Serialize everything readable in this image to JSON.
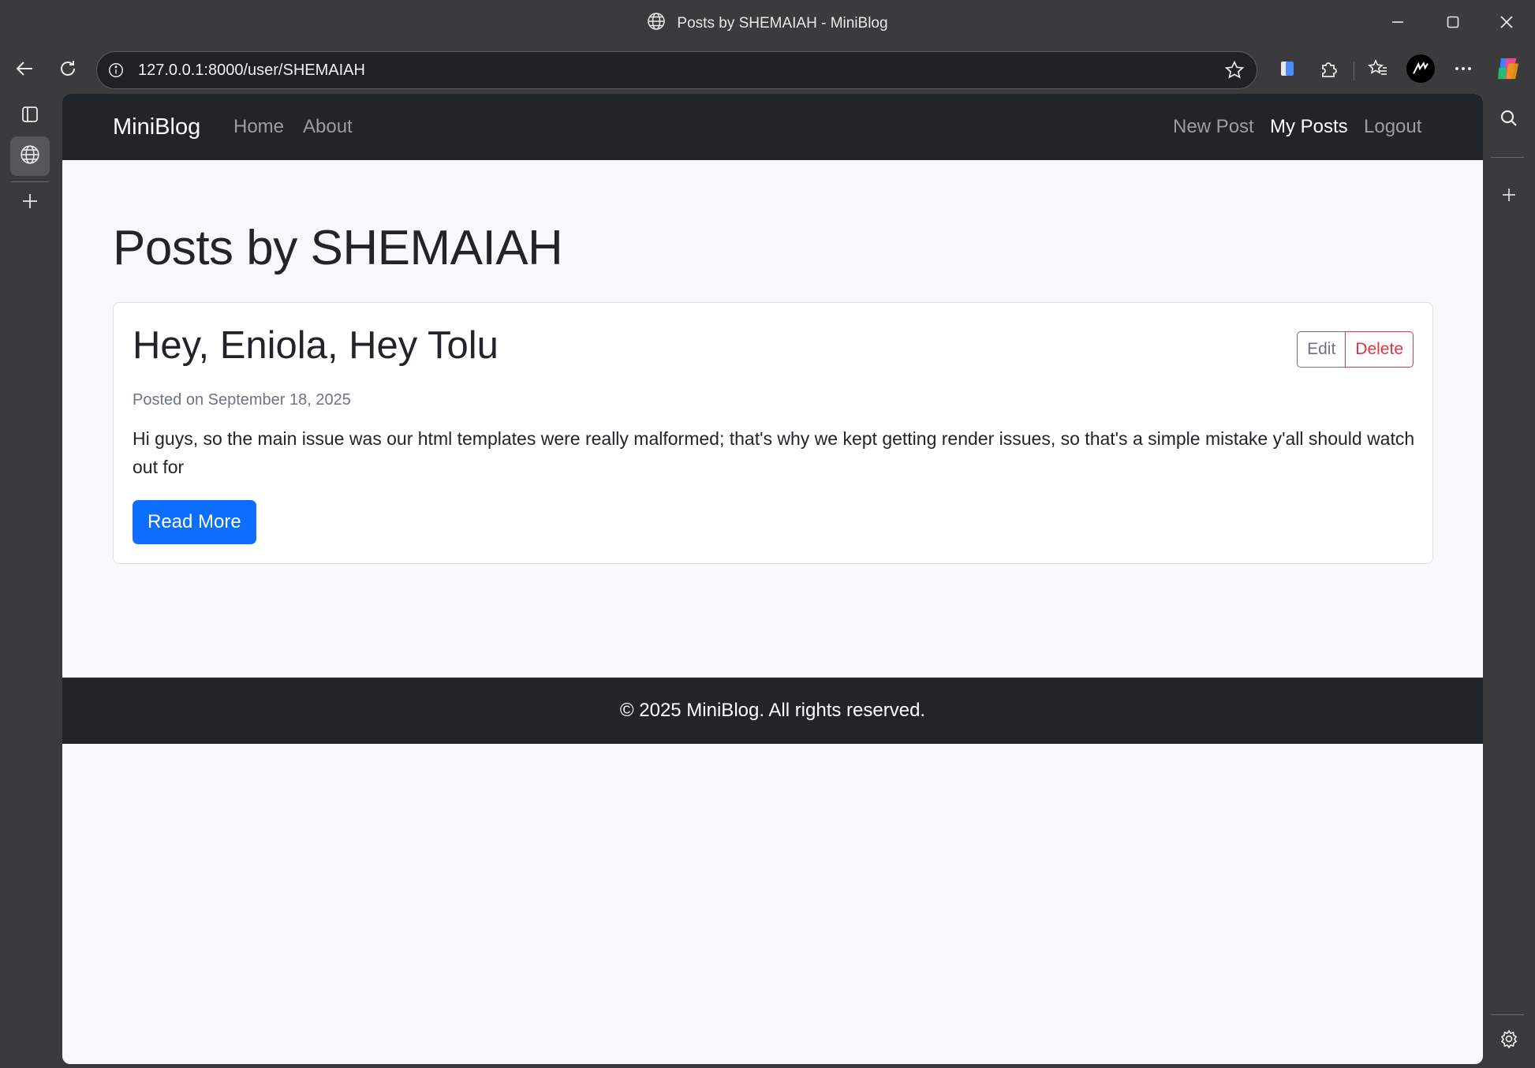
{
  "window": {
    "title": "Posts by SHEMAIAH - MiniBlog",
    "minimize_icon": "minimize-icon",
    "maximize_icon": "maximize-icon",
    "close_icon": "close-icon"
  },
  "toolbar": {
    "url": "127.0.0.1:8000/user/SHEMAIAH",
    "icons": [
      "back-arrow-icon",
      "refresh-icon",
      "site-info-icon",
      "favorite-star-icon",
      "reading-mode-icon",
      "extensions-icon",
      "favorites-icon",
      "profile-avatar-icon",
      "more-options-icon",
      "copilot-icon"
    ]
  },
  "sidebar_left": {
    "icons": [
      "tab-actions-icon",
      "globe-tab-icon",
      "add-tab-icon"
    ]
  },
  "sidebar_right": {
    "icons": [
      "search-icon",
      "add-icon",
      "settings-gear-icon"
    ]
  },
  "navbar": {
    "brand": "MiniBlog",
    "left_links": [
      "Home",
      "About"
    ],
    "right_links": [
      "New Post",
      "My Posts",
      "Logout"
    ],
    "active_link": "My Posts"
  },
  "main": {
    "heading": "Posts by SHEMAIAH",
    "posts": [
      {
        "title": "Hey, Eniola, Hey Tolu",
        "edit_label": "Edit",
        "delete_label": "Delete",
        "meta": "Posted on September 18, 2025",
        "excerpt": "Hi guys, so the main issue was our html templates were really malformed; that's why we kept getting render issues, so that's a simple mistake y'all should watch out for",
        "read_more_label": "Read More"
      }
    ]
  },
  "footer": {
    "text": "© 2025 MiniBlog. All rights reserved."
  },
  "colors": {
    "navbar_bg": "#212529",
    "primary": "#0d6efd",
    "danger": "#dc3545",
    "secondary": "#6c757d",
    "page_bg": "#f8f9fa"
  }
}
